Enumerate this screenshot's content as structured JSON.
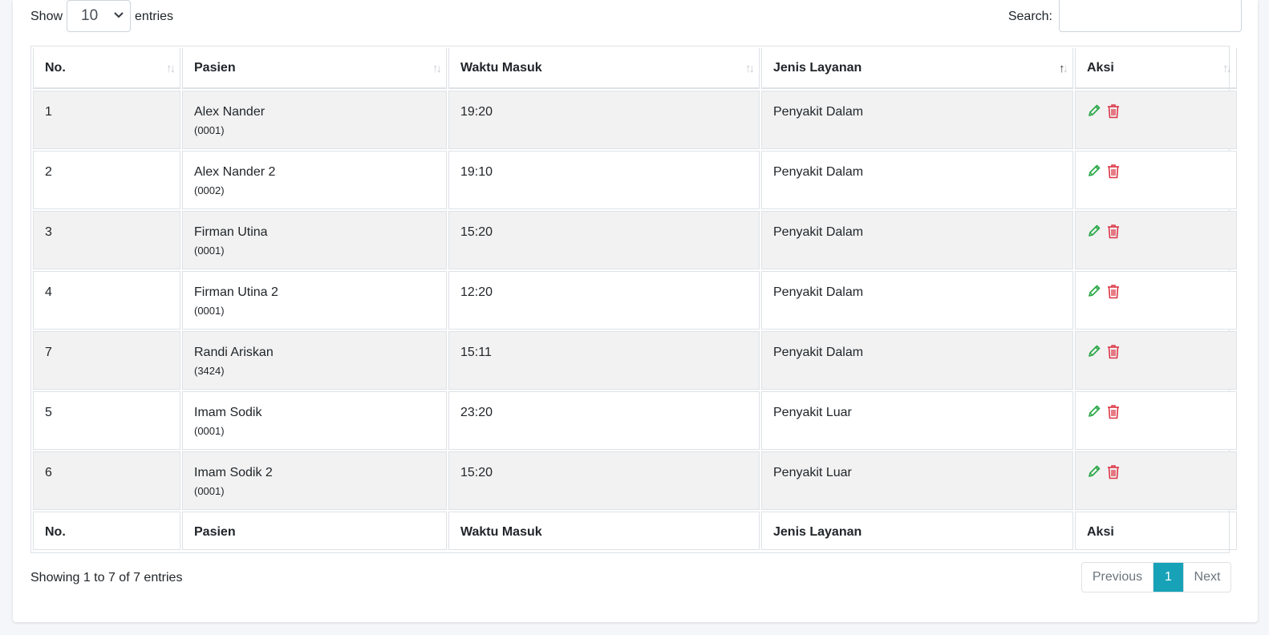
{
  "controls": {
    "show_label": "Show",
    "entries_value": "10",
    "entries_label": "entries",
    "search_label": "Search:",
    "search_value": ""
  },
  "table": {
    "columns": [
      "No.",
      "Pasien",
      "Waktu Masuk",
      "Jenis Layanan",
      "Aksi"
    ],
    "sorted_column": "Jenis Layanan",
    "rows": [
      {
        "no": "1",
        "name": "Alex Nander",
        "id": "(0001)",
        "time": "19:20",
        "service": "Penyakit Dalam"
      },
      {
        "no": "2",
        "name": "Alex Nander 2",
        "id": "(0002)",
        "time": "19:10",
        "service": "Penyakit Dalam"
      },
      {
        "no": "3",
        "name": "Firman Utina",
        "id": "(0001)",
        "time": "15:20",
        "service": "Penyakit Dalam"
      },
      {
        "no": "4",
        "name": "Firman Utina 2",
        "id": "(0001)",
        "time": "12:20",
        "service": "Penyakit Dalam"
      },
      {
        "no": "7",
        "name": "Randi Ariskan",
        "id": "(3424)",
        "time": "15:11",
        "service": "Penyakit Dalam"
      },
      {
        "no": "5",
        "name": "Imam Sodik",
        "id": "(0001)",
        "time": "23:20",
        "service": "Penyakit Luar"
      },
      {
        "no": "6",
        "name": "Imam Sodik 2",
        "id": "(0001)",
        "time": "15:20",
        "service": "Penyakit Luar"
      }
    ],
    "actions": {
      "edit_icon": "pencil-icon",
      "delete_icon": "trash-icon"
    }
  },
  "footer": {
    "info": "Showing 1 to 7 of 7 entries",
    "previous": "Previous",
    "current_page": "1",
    "next": "Next"
  },
  "colors": {
    "edit": "#28a745",
    "delete": "#dc3545",
    "page_active": "#17a2b8"
  }
}
